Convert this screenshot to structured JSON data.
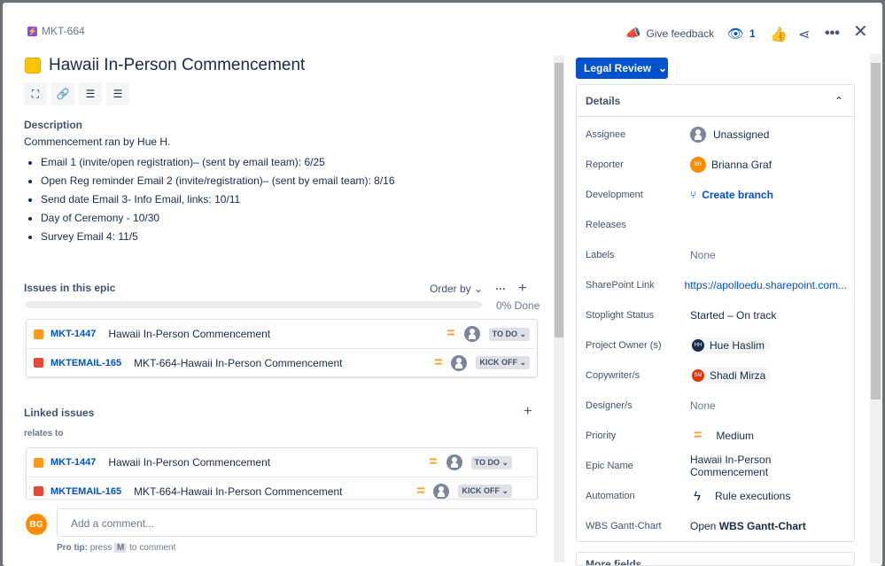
{
  "issue_key": "MKT-664",
  "header": {
    "feedback": "Give feedback",
    "watchers": "1"
  },
  "title": "Hawaii In-Person Commencement",
  "status_button": "Legal Review",
  "description": {
    "label": "Description",
    "intro": "Commencement ran by Hue H.",
    "items": [
      "Email 1 (invite/open registration)– (sent by email team): 6/25",
      "Open Reg reminder Email 2 (invite/registration)– (sent by email team): 8/16",
      "Send date Email 3- Info Email, links: 10/11",
      "Day of Ceremony - 10/30",
      "Survey Email 4:  11/5"
    ]
  },
  "epic": {
    "label": "Issues in this epic",
    "order_by": "Order by",
    "progress_percent": 0,
    "progress_text": "0% Done",
    "issues": [
      {
        "key": "MKT-1447",
        "summary": "Hawaii In-Person Commencement",
        "status": "TO DO",
        "type_color": "#ff991f"
      },
      {
        "key": "MKTEMAIL-165",
        "summary": "MKT-664-Hawaii In-Person Commencement",
        "status": "KICK OFF",
        "type_color": "#e5493a"
      }
    ]
  },
  "linked": {
    "label": "Linked issues",
    "relation": "relates to",
    "issues": [
      {
        "key": "MKT-1447",
        "summary": "Hawaii In-Person Commencement",
        "status": "TO DO",
        "type_color": "#ff991f"
      },
      {
        "key": "MKTEMAIL-165",
        "summary": "MKT-664-Hawaii In-Person Commencement",
        "status": "KICK OFF",
        "type_color": "#e5493a"
      }
    ]
  },
  "comment": {
    "avatar": "BG",
    "placeholder": "Add a comment...",
    "tip_prefix": "Pro tip:",
    "tip_press": "press",
    "tip_key": "M",
    "tip_suffix": "to comment"
  },
  "details": {
    "label": "Details",
    "fields": [
      {
        "k": "Assignee",
        "v": "Unassigned"
      },
      {
        "k": "Reporter",
        "v": "Brianna Graf",
        "initials": "BG"
      },
      {
        "k": "Development",
        "v": "Create branch"
      },
      {
        "k": "Releases",
        "v": ""
      },
      {
        "k": "Labels",
        "v": "None"
      },
      {
        "k": "SharePoint Link",
        "v": "https://apolloedu.sharepoint.com..."
      },
      {
        "k": "Stoplight Status",
        "v": "Started – On track"
      },
      {
        "k": "Project Owner (s)",
        "v": "Hue Haslim",
        "initials": "HH"
      },
      {
        "k": "Copywriter/s",
        "v": "Shadi Mirza",
        "initials": "SM"
      },
      {
        "k": "Designer/s",
        "v": "None"
      },
      {
        "k": "Priority",
        "v": "Medium"
      },
      {
        "k": "Epic Name",
        "v": "Hawaii In-Person Commencement"
      },
      {
        "k": "Automation",
        "v": "Rule executions"
      },
      {
        "k": "WBS Gantt-Chart",
        "v_prefix": "Open",
        "v": "WBS Gantt-Chart"
      }
    ]
  },
  "more_fields": "More fields"
}
